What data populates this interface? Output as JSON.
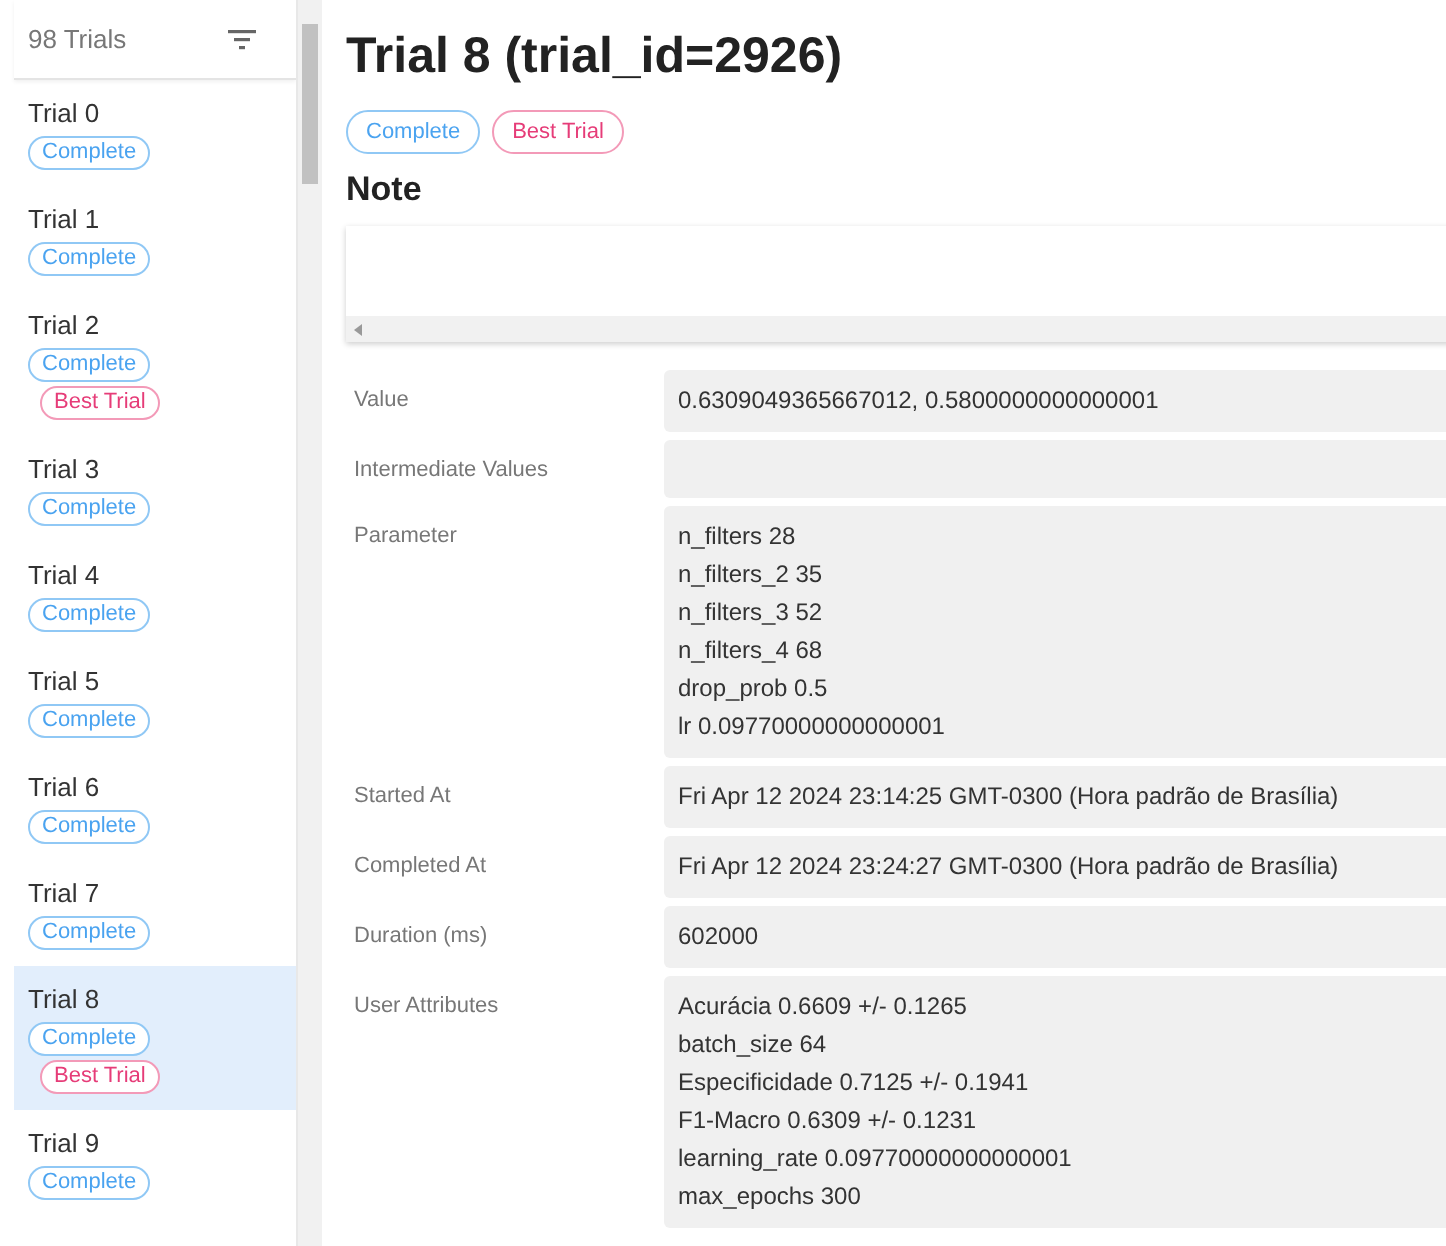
{
  "sidebar": {
    "header": "98 Trials",
    "items": [
      {
        "title": "Trial 0",
        "selected": false,
        "badges": [
          {
            "kind": "state",
            "label": "Complete"
          }
        ]
      },
      {
        "title": "Trial 1",
        "selected": false,
        "badges": [
          {
            "kind": "state",
            "label": "Complete"
          }
        ]
      },
      {
        "title": "Trial 2",
        "selected": false,
        "badges": [
          {
            "kind": "state",
            "label": "Complete"
          },
          {
            "kind": "best",
            "label": "Best Trial"
          }
        ]
      },
      {
        "title": "Trial 3",
        "selected": false,
        "badges": [
          {
            "kind": "state",
            "label": "Complete"
          }
        ]
      },
      {
        "title": "Trial 4",
        "selected": false,
        "badges": [
          {
            "kind": "state",
            "label": "Complete"
          }
        ]
      },
      {
        "title": "Trial 5",
        "selected": false,
        "badges": [
          {
            "kind": "state",
            "label": "Complete"
          }
        ]
      },
      {
        "title": "Trial 6",
        "selected": false,
        "badges": [
          {
            "kind": "state",
            "label": "Complete"
          }
        ]
      },
      {
        "title": "Trial 7",
        "selected": false,
        "badges": [
          {
            "kind": "state",
            "label": "Complete"
          }
        ]
      },
      {
        "title": "Trial 8",
        "selected": true,
        "badges": [
          {
            "kind": "state",
            "label": "Complete"
          },
          {
            "kind": "best",
            "label": "Best Trial"
          }
        ]
      },
      {
        "title": "Trial 9",
        "selected": false,
        "badges": [
          {
            "kind": "state",
            "label": "Complete"
          }
        ]
      }
    ]
  },
  "detail": {
    "title": "Trial 8 (trial_id=2926)",
    "badges": [
      {
        "kind": "state",
        "label": "Complete"
      },
      {
        "kind": "best",
        "label": "Best Trial"
      }
    ],
    "note_heading": "Note",
    "fields": [
      {
        "label": "Value",
        "lines": [
          "0.6309049365667012, 0.5800000000000001"
        ]
      },
      {
        "label": "Intermediate Values"
      },
      {
        "label": "Parameter",
        "lines": [
          "n_filters 28",
          "n_filters_2 35",
          "n_filters_3 52",
          "n_filters_4 68",
          "drop_prob 0.5",
          "lr 0.09770000000000001"
        ]
      },
      {
        "label": "Started At",
        "lines": [
          "Fri Apr 12 2024 23:14:25 GMT-0300 (Hora padrão de Brasília)"
        ]
      },
      {
        "label": "Completed At",
        "lines": [
          "Fri Apr 12 2024 23:24:27 GMT-0300 (Hora padrão de Brasília)"
        ]
      },
      {
        "label": "Duration (ms)",
        "lines": [
          "602000"
        ]
      },
      {
        "label": "User Attributes",
        "lines": [
          "Acurácia 0.6609 +/- 0.1265",
          "batch_size 64",
          "Especificidade 0.7125 +/- 0.1941",
          "F1-Macro 0.6309 +/- 0.1231",
          "learning_rate 0.09770000000000001",
          "max_epochs 300"
        ]
      }
    ]
  }
}
